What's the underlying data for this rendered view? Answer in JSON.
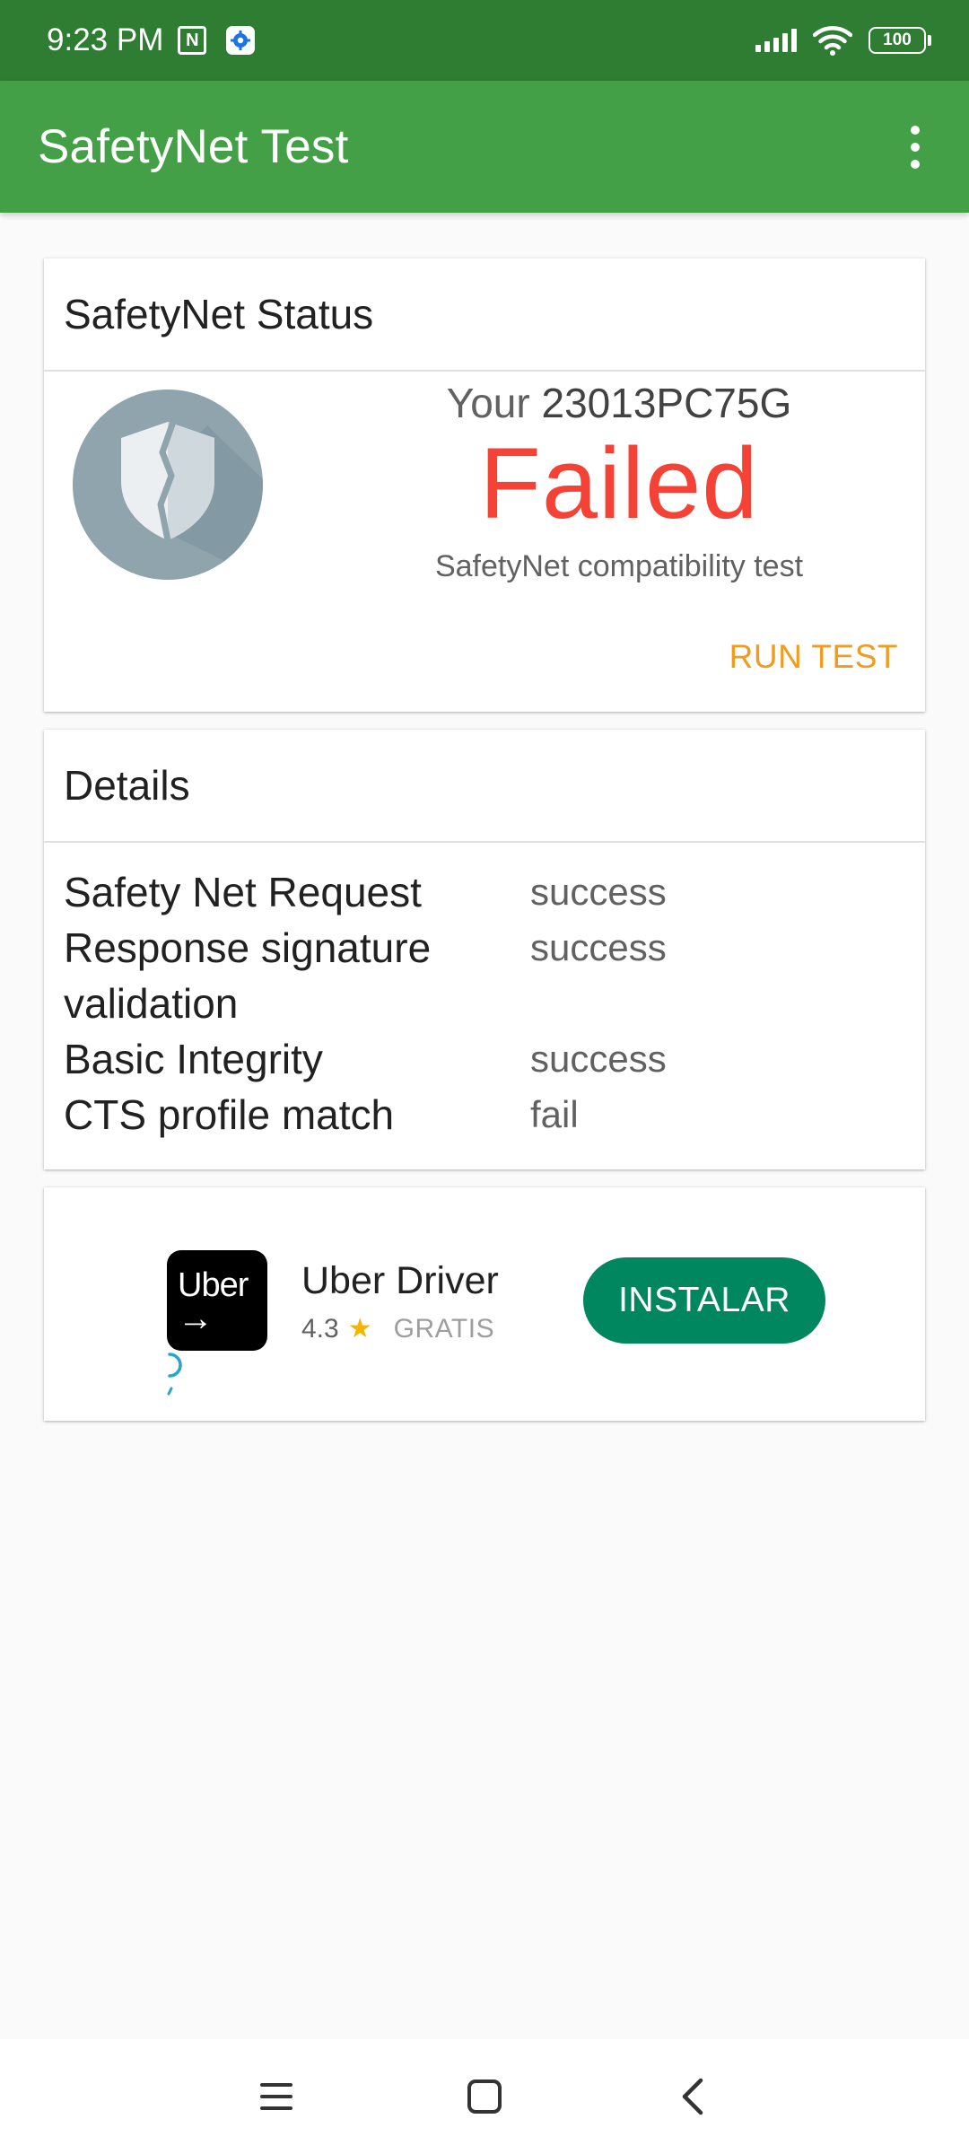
{
  "status_bar": {
    "time": "9:23 PM",
    "battery": "100",
    "icons": [
      "nfc-icon",
      "gear-icon",
      "signal-icon",
      "wifi-icon",
      "battery-icon"
    ]
  },
  "toolbar": {
    "title": "SafetyNet Test",
    "menu_icon": "overflow-menu-icon"
  },
  "status_card": {
    "header": "SafetyNet Status",
    "device_prefix": "Your",
    "device_model": "23013PC75G",
    "result": "Failed",
    "subtitle": "SafetyNet compatibility test",
    "action": "RUN TEST",
    "icon": "broken-shield-icon",
    "colors": {
      "result": "#f44336",
      "action": "#f29c1f"
    }
  },
  "details_card": {
    "header": "Details",
    "rows": [
      {
        "label": "Safety Net Request",
        "value": "success"
      },
      {
        "label": "Response signature validation",
        "value": "success"
      },
      {
        "label": "Basic Integrity",
        "value": "success"
      },
      {
        "label": "CTS profile match",
        "value": "fail"
      }
    ]
  },
  "ad_card": {
    "icon_text": "Uber",
    "app_name": "Uber Driver",
    "rating": "4.3",
    "star": "★",
    "price": "GRATIS",
    "install_label": "INSTALAR",
    "colors": {
      "install": "#01875f"
    }
  },
  "nav_bar": {
    "buttons": [
      "menu-icon",
      "home-icon",
      "back-icon"
    ]
  },
  "colors": {
    "status_bar": "#2e7d32",
    "toolbar": "#43a047",
    "background": "#fafafa"
  }
}
